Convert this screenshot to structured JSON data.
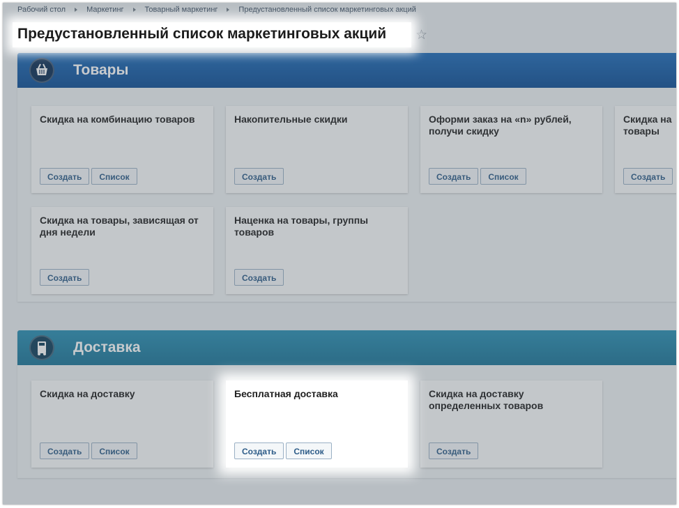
{
  "breadcrumb": [
    "Рабочий стол",
    "Маркетинг",
    "Товарный маркетинг",
    "Предустановленный список маркетинговых акций"
  ],
  "page_title": "Предустановленный список маркетинговых акций",
  "sections": {
    "goods": {
      "title": "Товары",
      "icon": "basket-icon",
      "cards": [
        {
          "title": "Скидка на комбинацию товаров",
          "create": "Создать",
          "list": "Список"
        },
        {
          "title": "Накопительные скидки",
          "create": "Создать"
        },
        {
          "title": "Оформи заказ на «n» рублей, получи скидку",
          "create": "Создать",
          "list": "Список"
        },
        {
          "title": "Скидка на товары",
          "create": "Создать"
        },
        {
          "title": "Скидка на товары, зависящая от дня недели",
          "create": "Создать"
        },
        {
          "title": "Наценка на товары, группы товаров",
          "create": "Создать"
        }
      ]
    },
    "delivery": {
      "title": "Доставка",
      "icon": "truck-icon",
      "cards": [
        {
          "title": "Скидка на доставку",
          "create": "Создать",
          "list": "Список"
        },
        {
          "title": "Бесплатная доставка",
          "create": "Создать",
          "list": "Список"
        },
        {
          "title": "Скидка на доставку определенных товаров",
          "create": "Создать"
        }
      ]
    }
  },
  "colors": {
    "goods_header": "#1c64b0",
    "delivery_header": "#2488ab",
    "button_text": "#2d5c88"
  }
}
